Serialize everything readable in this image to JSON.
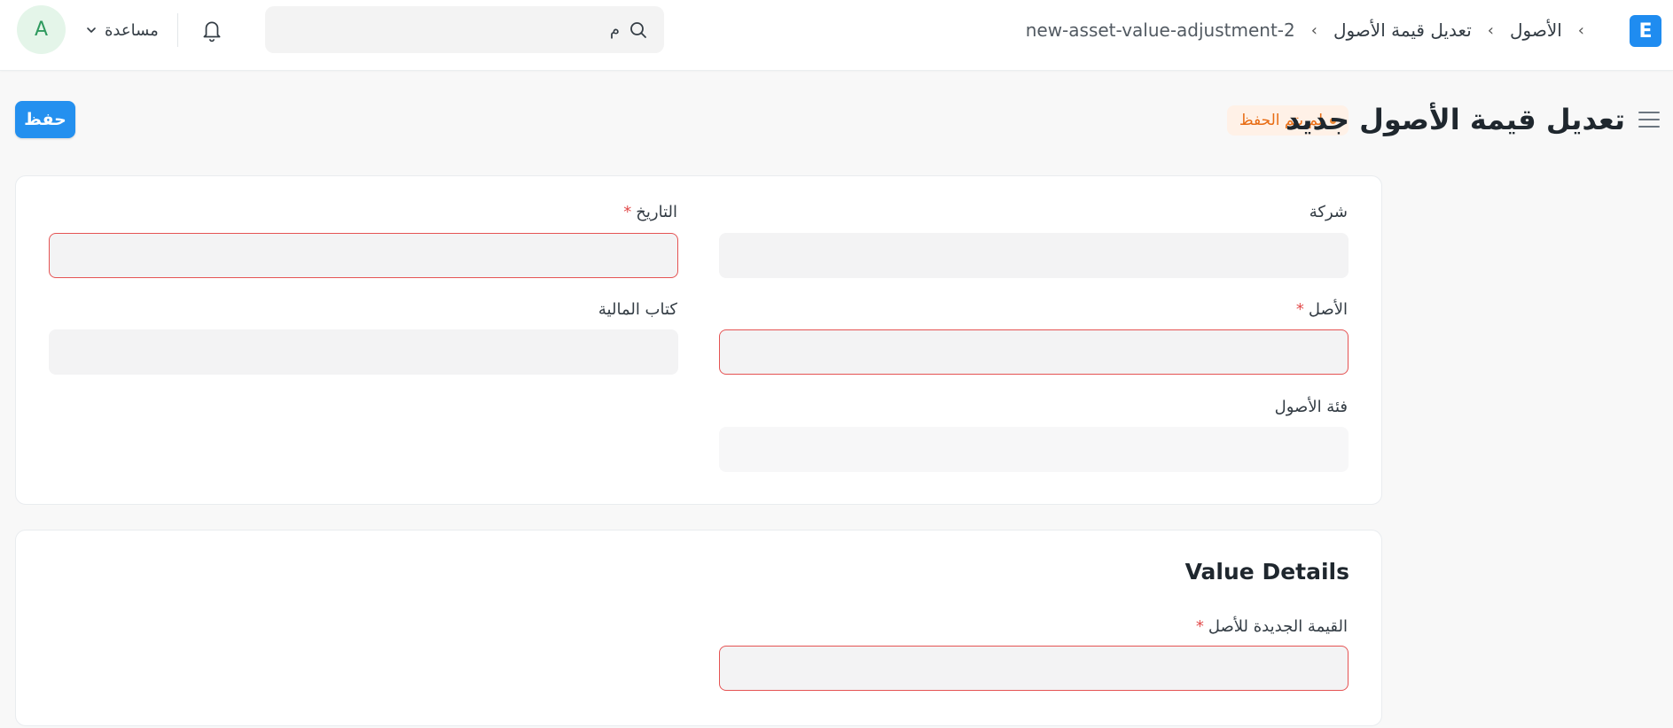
{
  "navbar": {
    "avatar_letter": "A",
    "help_label": "مساعدة",
    "search_value": "م",
    "breadcrumbs": [
      "الأصول",
      "تعديل قيمة الأصول",
      "new-asset-value-adjustment-2"
    ],
    "logo_letter": "E"
  },
  "page": {
    "title": "تعديل قيمة الأصول جديد",
    "status": "لم يتم الحفظ",
    "save_label": "حفظ"
  },
  "form": {
    "company_label": "شركة",
    "date_label": "التاريخ",
    "asset_label": "الأصل",
    "finance_book_label": "كتاب المالية",
    "asset_category_label": "فئة الأصول",
    "required_mark": "*"
  },
  "value_details": {
    "section_title": "Value Details",
    "new_asset_value_label": "القيمة الجديدة للأصل"
  },
  "colors": {
    "accent": "#2490ef",
    "error_border": "#e55353",
    "status_text": "#e86c13",
    "status_bg": "#fff1e7"
  }
}
